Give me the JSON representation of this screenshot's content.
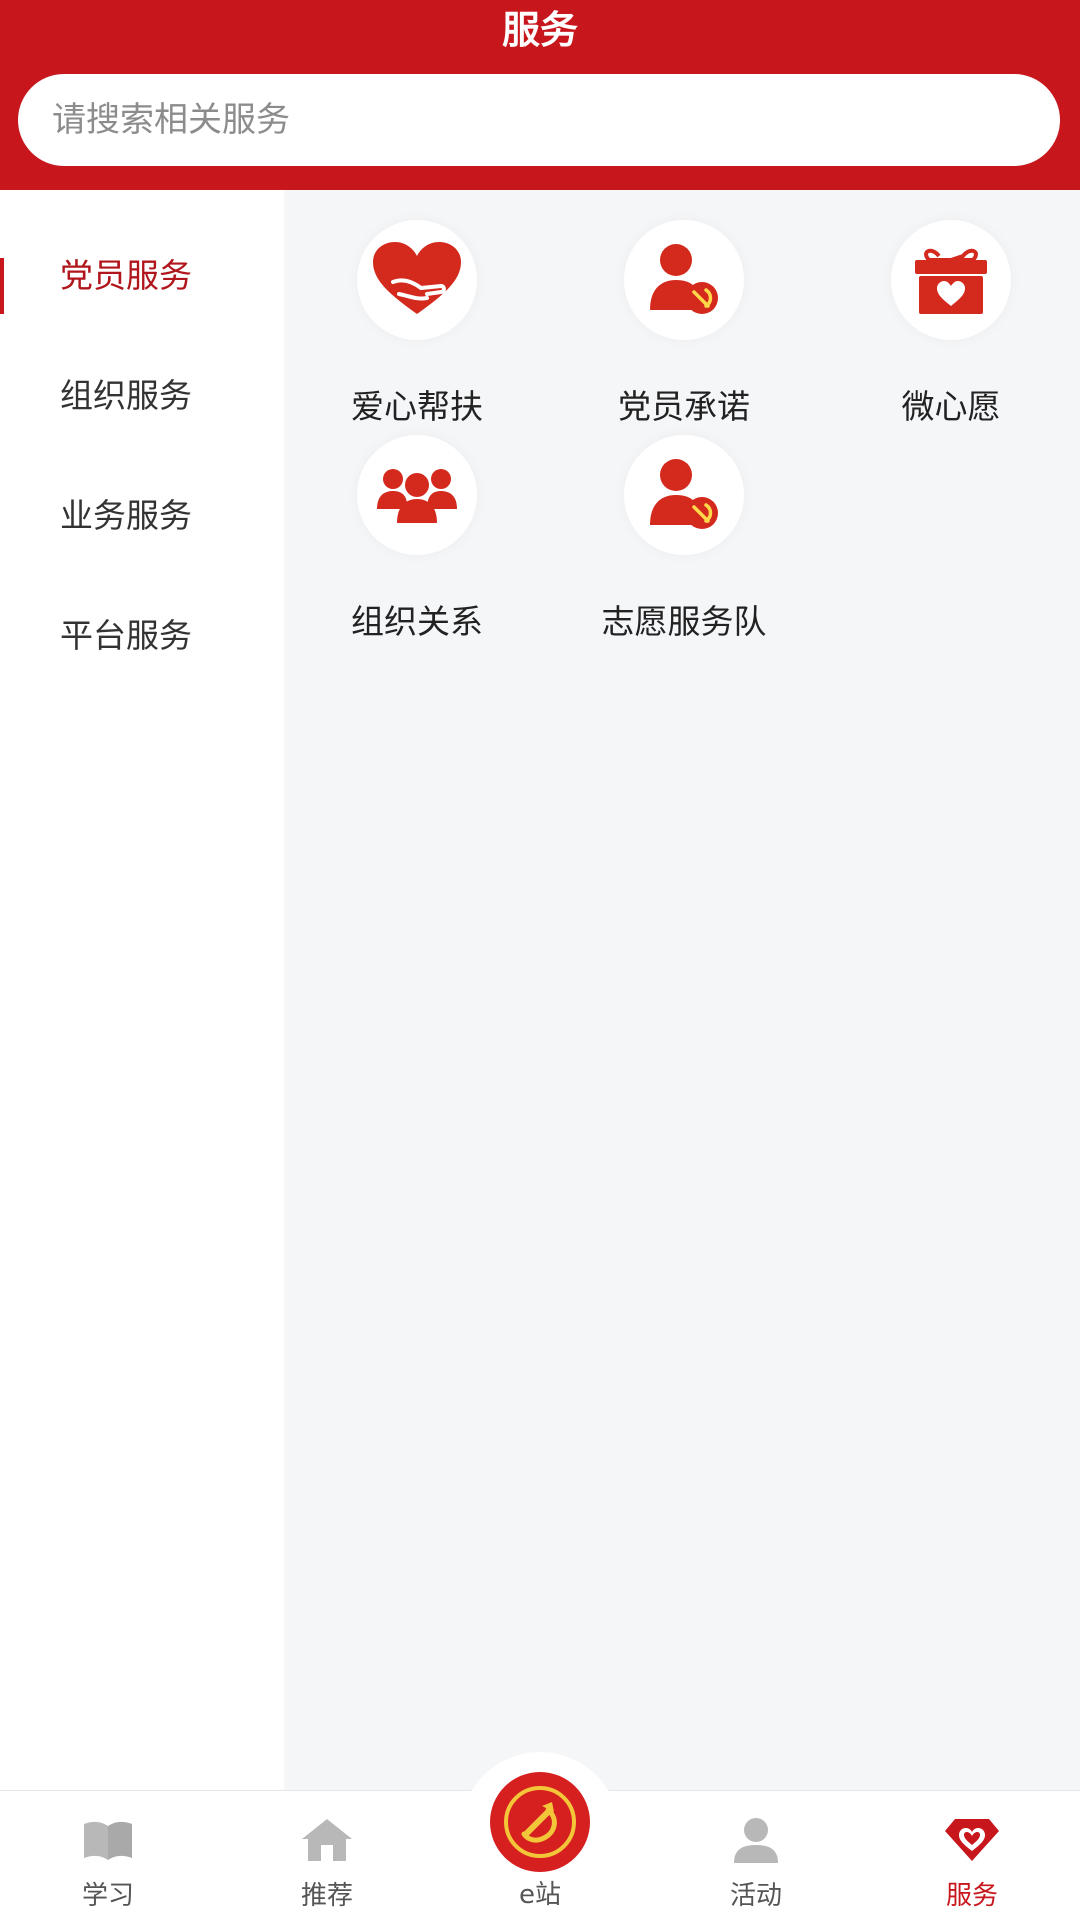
{
  "header": {
    "title": "服务"
  },
  "search": {
    "placeholder": "请搜索相关服务"
  },
  "sidebar": {
    "items": [
      {
        "label": "党员服务",
        "active": true
      },
      {
        "label": "组织服务",
        "active": false
      },
      {
        "label": "业务服务",
        "active": false
      },
      {
        "label": "平台服务",
        "active": false
      }
    ]
  },
  "services": [
    {
      "label": "爱心帮扶",
      "icon": "heart-hands-icon"
    },
    {
      "label": "党员承诺",
      "icon": "party-member-icon"
    },
    {
      "label": "微心愿",
      "icon": "gift-heart-icon"
    },
    {
      "label": "组织关系",
      "icon": "group-icon"
    },
    {
      "label": "志愿服务队",
      "icon": "party-member-icon"
    }
  ],
  "bottom_nav": {
    "items": [
      {
        "label": "学习",
        "icon": "book-icon",
        "active": false
      },
      {
        "label": "推荐",
        "icon": "home-icon",
        "active": false
      },
      {
        "label": "e站",
        "icon": "party-emblem-icon",
        "active": false
      },
      {
        "label": "活动",
        "icon": "person-icon",
        "active": false
      },
      {
        "label": "服务",
        "icon": "heart-gem-icon",
        "active": true
      }
    ]
  },
  "colors": {
    "brand_red": "#c8161d",
    "active_text": "#b0161c",
    "content_bg": "#f5f6f8",
    "inactive_icon": "#b8b8b8"
  }
}
